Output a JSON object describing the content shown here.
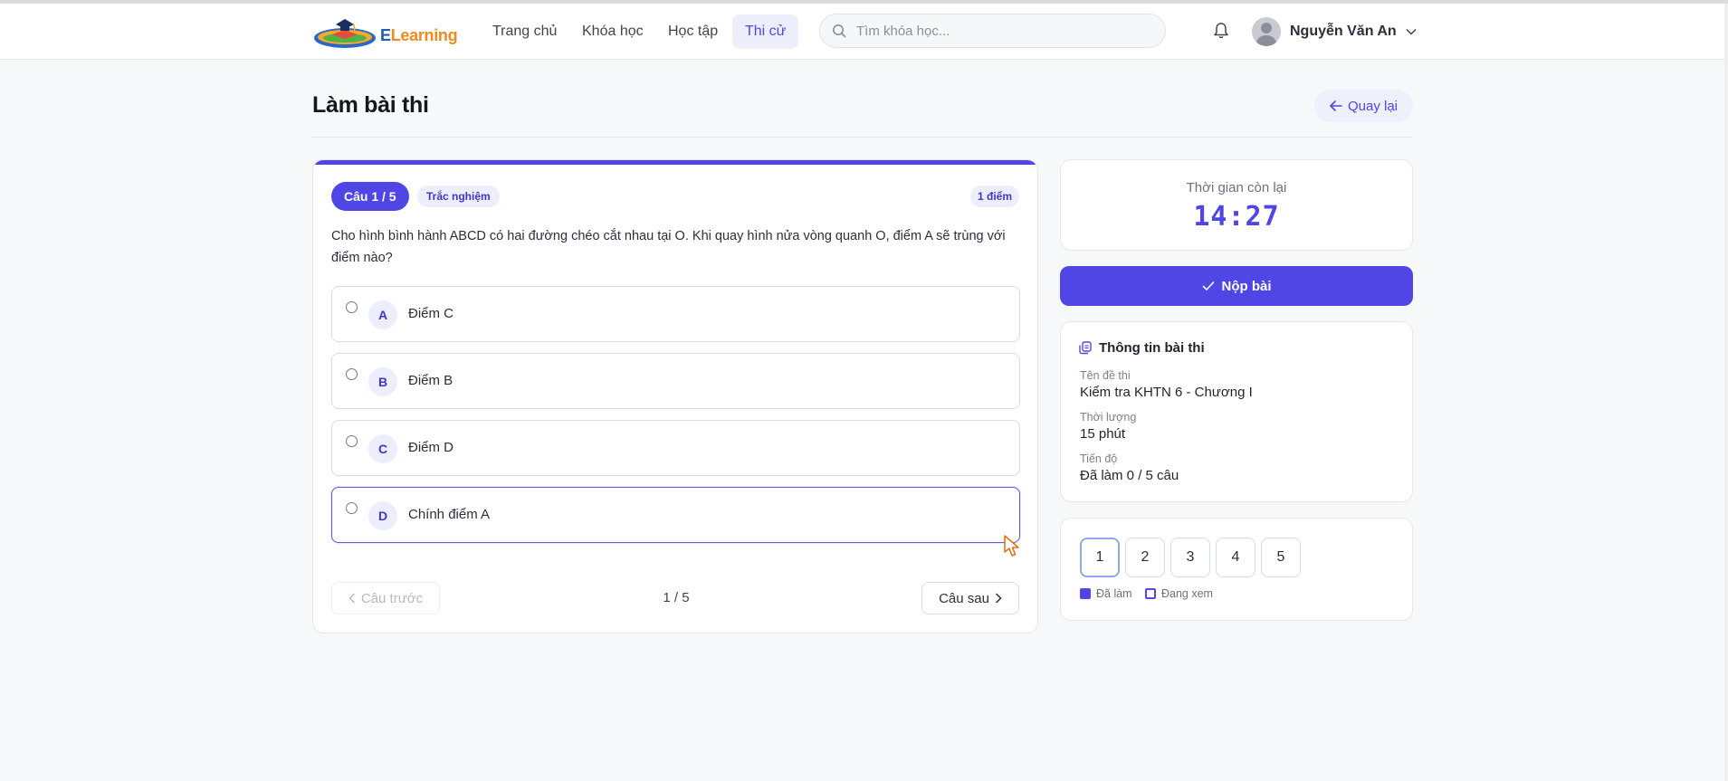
{
  "app": {
    "logo_letter_e": "E",
    "logo_rest": "Learning",
    "nav": [
      "Trang chủ",
      "Khóa học",
      "Học tập",
      "Thi cử"
    ],
    "active_nav": "Thi cử",
    "search_placeholder": "Tìm khóa học...",
    "user_name": "Nguyễn Văn An"
  },
  "page": {
    "title": "Làm bài thi",
    "back_label": "Quay lại"
  },
  "question": {
    "label": "Câu 1 / 5",
    "type": "Trắc nghiệm",
    "points": "1 điểm",
    "text": "Cho hình bình hành ABCD có hai đường chéo cắt nhau tại O. Khi quay hình nửa vòng quanh O, điểm A sẽ trùng với điểm nào?",
    "options": [
      {
        "letter": "A",
        "text": "Điểm C"
      },
      {
        "letter": "B",
        "text": "Điểm B"
      },
      {
        "letter": "C",
        "text": "Điểm D"
      },
      {
        "letter": "D",
        "text": "Chính điểm A"
      }
    ],
    "prev_label": "Câu trước",
    "counter": "1 / 5",
    "next_label": "Câu sau"
  },
  "timer": {
    "label": "Thời gian còn lại",
    "value": "14:27"
  },
  "submit_label": "Nộp bài",
  "info": {
    "heading": "Thông tin bài thi",
    "exam_name_label": "Tên đề thi",
    "exam_name": "Kiểm tra KHTN 6 - Chương I",
    "duration_label": "Thời lượng",
    "duration": "15 phút",
    "progress_label": "Tiến độ",
    "progress": "Đã làm 0 / 5 câu"
  },
  "question_nav": {
    "numbers": [
      "1",
      "2",
      "3",
      "4",
      "5"
    ],
    "current": "1",
    "legend_done": "Đã làm",
    "legend_viewing": "Đang xem"
  },
  "colors": {
    "primary": "#4f46e5",
    "primary_soft": "#eceefb"
  }
}
